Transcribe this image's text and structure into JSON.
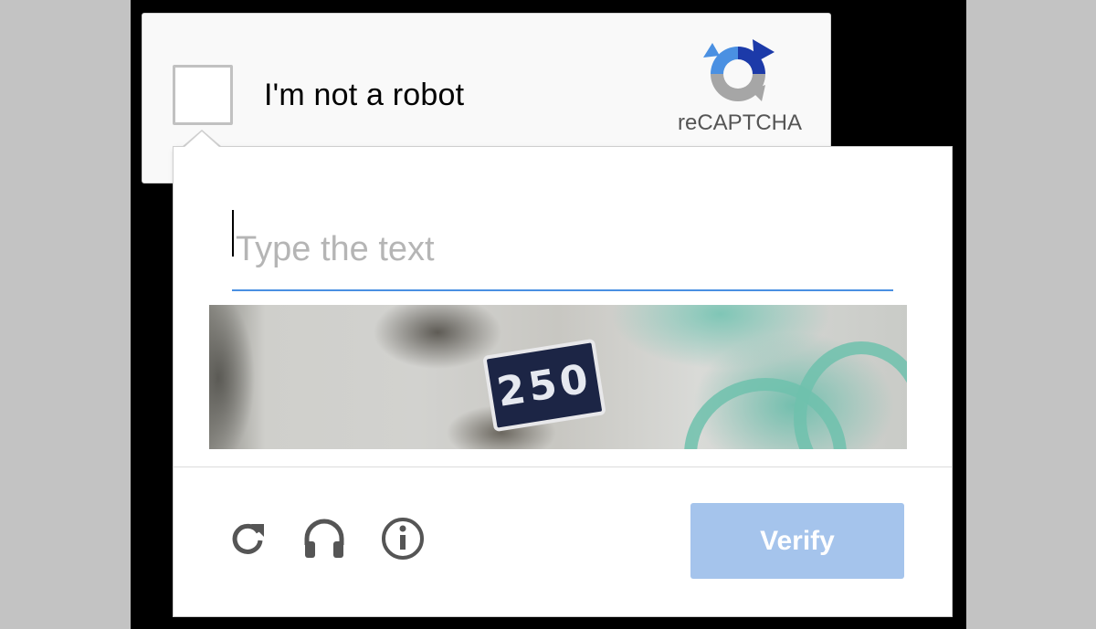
{
  "anchor": {
    "checkbox_label": "I'm not a robot",
    "brand": "reCAPTCHA"
  },
  "challenge": {
    "input_placeholder": "Type the text",
    "input_value": "",
    "image_text": "250",
    "verify_label": "Verify"
  },
  "icons": {
    "reload": "reload-icon",
    "audio": "headphones-icon",
    "info": "info-icon",
    "logo": "recaptcha-logo-icon"
  },
  "colors": {
    "accent_blue": "#4a90e2",
    "verify_button": "#a5c4ec",
    "logo_blue": "#1c3aa9",
    "logo_light_blue": "#4a90e2",
    "logo_gray": "#a6a6a6"
  }
}
